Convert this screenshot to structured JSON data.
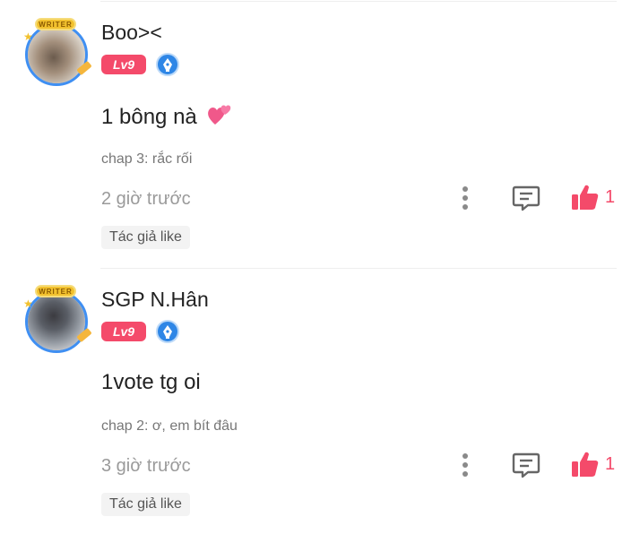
{
  "colors": {
    "accent": "#f44a6a",
    "writer_badge": "#2e86e6",
    "divider": "#eeeeee",
    "muted_text": "#9a9a9a"
  },
  "comments": [
    {
      "username": "Boo><",
      "level": "Lv9",
      "avatar_frame_label": "WRITER",
      "text": "1 bông nà",
      "emoji": "two-hearts-emoji",
      "chapter": "chap 3: rắc rối",
      "time": "2 giờ trước",
      "likes": "1",
      "author_like": "Tác giả like"
    },
    {
      "username": "SGP N.Hân",
      "level": "Lv9",
      "avatar_frame_label": "WRITER",
      "text": "1vote tg oi",
      "chapter": "chap 2: ơ, em bít đâu",
      "time": "3 giờ trước",
      "likes": "1",
      "author_like": "Tác giả like"
    }
  ],
  "icons": {
    "more": "more-vertical-icon",
    "reply": "comment-reply-icon",
    "like": "thumbs-up-icon",
    "writer": "writer-pen-badge-icon"
  }
}
